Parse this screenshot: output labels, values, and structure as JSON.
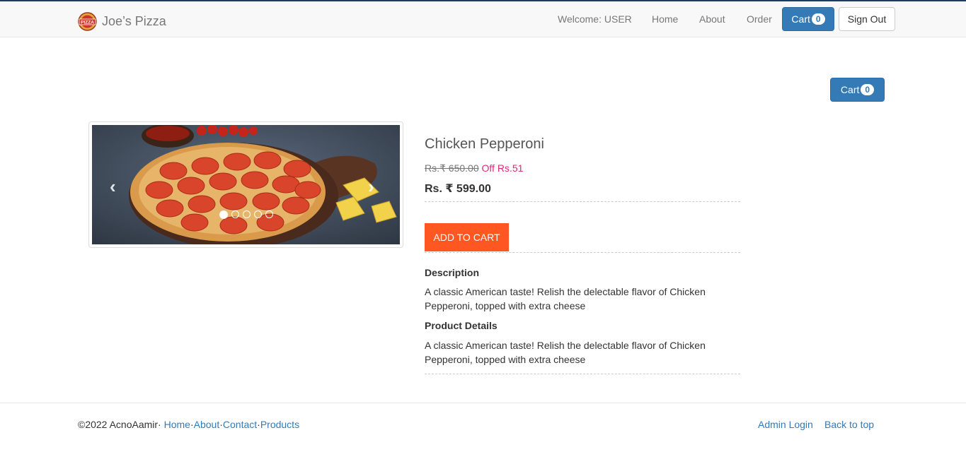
{
  "brand": {
    "name": "Joe’s Pizza",
    "logo_text": "PIZZA"
  },
  "nav": {
    "welcome": "Welcome: USER",
    "home": "Home",
    "about": "About",
    "order": "Order",
    "cart_label": "Cart",
    "cart_count": "0",
    "sign_out": "Sign Out"
  },
  "page_cart": {
    "label": "Cart",
    "count": "0"
  },
  "carousel": {
    "prev_icon": "‹",
    "next_icon": "›",
    "slide_count": 5,
    "active_slide": 1
  },
  "product": {
    "name": "Chicken Pepperoni",
    "old_price": "Rs.₹ 650.00",
    "discount": "Off Rs.51",
    "price": "Rs. ₹ 599.00",
    "add_to_cart": "ADD TO CART",
    "description_heading": "Description",
    "description": "A classic American taste! Relish the delectable flavor of Chicken Pepperoni, topped with extra cheese",
    "details_heading": "Product Details",
    "details": "A classic American taste! Relish the delectable flavor of Chicken Pepperoni, topped with extra cheese"
  },
  "footer": {
    "copyright": "©2022 AcnoAamir·",
    "links": [
      "Home",
      "About",
      "Contact",
      "Products"
    ],
    "admin_login": "Admin Login",
    "back_to_top": "Back to top"
  },
  "colors": {
    "primary": "#337ab7",
    "accent": "#ff5722",
    "discount": "#e0297a"
  }
}
